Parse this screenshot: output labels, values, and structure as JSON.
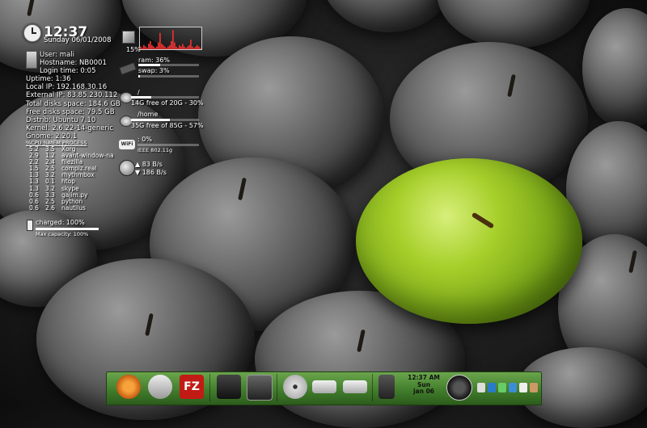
{
  "clock": {
    "time": "12:37",
    "date": "Sunday 06/01/2008"
  },
  "system": {
    "user": "User: mali",
    "hostname": "Hostname: NB0001",
    "login": "Login time: 0:05",
    "uptime": "Uptime: 1:36",
    "local_ip": "Local IP: 192.168.30.16",
    "external_ip": "External IP: 83.85.230.112",
    "total_disk": "Total disks space: 184.6 GB",
    "free_disk": "Free disks space: 79.5 GB",
    "distrib": "Distrib: Ubuntu 7.10",
    "kernel": "Kernel: 2.6.22-14-generic",
    "gnome": "Gnome: 2.20.1"
  },
  "processes": {
    "header": "%CPU %MEM PROCESS",
    "rows": [
      {
        "cpu": "5.2",
        "mem": "3.5",
        "name": "Xorg"
      },
      {
        "cpu": "2.9",
        "mem": "1.2",
        "name": "avant-window-na"
      },
      {
        "cpu": "2.2",
        "mem": "2.4",
        "name": "filezilla"
      },
      {
        "cpu": "1.5",
        "mem": "2.5",
        "name": "compiz.real"
      },
      {
        "cpu": "1.3",
        "mem": "3.2",
        "name": "rhythmbox"
      },
      {
        "cpu": "1.3",
        "mem": "0.1",
        "name": "htop"
      },
      {
        "cpu": "1.3",
        "mem": "3.2",
        "name": "skype"
      },
      {
        "cpu": "0.6",
        "mem": "3.3",
        "name": "gajim.py"
      },
      {
        "cpu": "0.6",
        "mem": "2.5",
        "name": "python"
      },
      {
        "cpu": "0.6",
        "mem": "2.6",
        "name": "nautilus"
      }
    ]
  },
  "battery": {
    "status": "charged: 100%",
    "capacity": "Max capacity: 100%",
    "level": 1.0
  },
  "cpu": {
    "percent": "15%",
    "graph": [
      2,
      1,
      3,
      2,
      1,
      4,
      6,
      3,
      2,
      1,
      2,
      5,
      12,
      4,
      3,
      2,
      1,
      2,
      3,
      6,
      14,
      5,
      2,
      1,
      3,
      2,
      4,
      2,
      1,
      2,
      3,
      7,
      2,
      1,
      2,
      3,
      2,
      1
    ]
  },
  "memory": {
    "ram": "ram: 36%",
    "ram_level": 0.36,
    "swap": "swap: 3%",
    "swap_level": 0.03
  },
  "disks": [
    {
      "mount": "/",
      "info": "14G free of 20G - 30%",
      "level": 0.3
    },
    {
      "mount": "/home",
      "info": "35G free of 85G - 57%",
      "level": 0.57
    }
  ],
  "wifi": {
    "quality": ": 0%",
    "name": "IEEE 802.11g",
    "level": 0.0,
    "icon_text": "WiFi"
  },
  "network": {
    "up": "▲ 83 B/s",
    "down": "▼ 186 B/s"
  },
  "dock": {
    "time": "12:37 AM",
    "day": "Sun",
    "date": "jan 06",
    "items": [
      "ubuntu-menu",
      "web-browser",
      "filezilla",
      "camera",
      "terminal",
      "cd-drive",
      "harddisk",
      "harddisk-2",
      "speaker",
      "dock-clock",
      "power-button",
      "system-tray"
    ],
    "filezilla_label": "FZ"
  },
  "colors": {
    "dock": "#4f8a35",
    "apple_green": "#a6cf2a"
  }
}
